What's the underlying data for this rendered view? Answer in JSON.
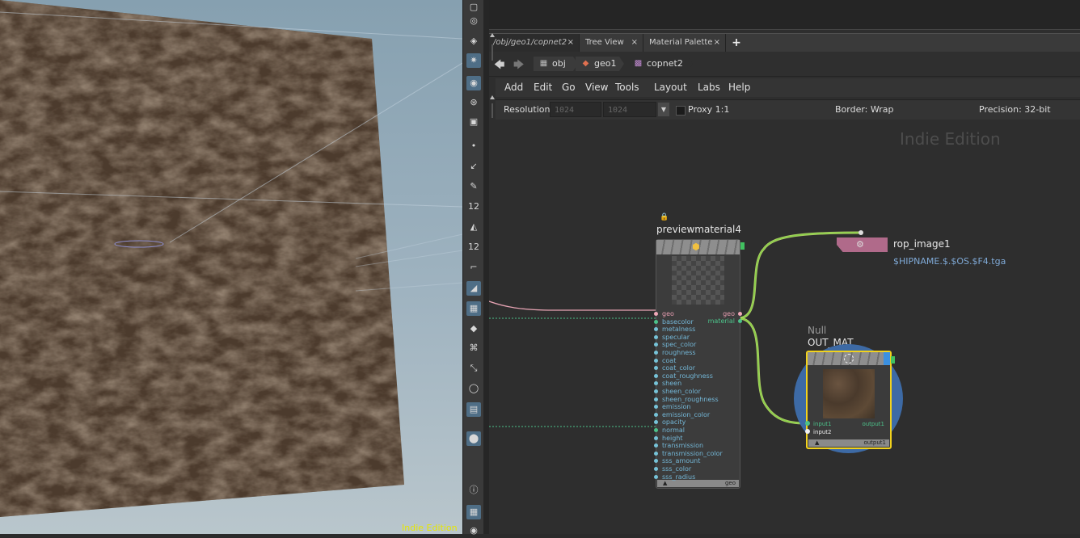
{
  "viewport": {
    "watermark": "Indie Edition"
  },
  "shelf": {
    "tools": [
      {
        "name": "select-tool",
        "glyph": "▢"
      },
      {
        "name": "view-tool",
        "glyph": "◎"
      },
      {
        "name": "handle-tool",
        "glyph": "◈"
      },
      {
        "name": "light-tool",
        "glyph": "✷"
      },
      {
        "name": "camera-tool",
        "glyph": "◉"
      },
      {
        "name": "orbit-tool",
        "glyph": "⊛"
      },
      {
        "name": "render-tool",
        "glyph": "▣"
      },
      {
        "name": "point-tool",
        "glyph": "•"
      },
      {
        "name": "edge-tool",
        "glyph": "↙"
      },
      {
        "name": "brush-tool",
        "glyph": "✎"
      },
      {
        "name": "number-tool",
        "glyph": "12"
      },
      {
        "name": "paint-tool",
        "glyph": "◭"
      },
      {
        "name": "number2-tool",
        "glyph": "12"
      },
      {
        "name": "corner-tool",
        "glyph": "⌐"
      },
      {
        "name": "plane-tool",
        "glyph": "◢"
      },
      {
        "name": "checker-tool",
        "glyph": "▦"
      },
      {
        "name": "layer-tool",
        "glyph": "◆"
      },
      {
        "name": "uv-tool",
        "glyph": "⌘"
      },
      {
        "name": "pin-tool",
        "glyph": "⤡"
      },
      {
        "name": "circle-tool",
        "glyph": "◯"
      },
      {
        "name": "image-tool",
        "glyph": "▤"
      },
      {
        "name": "marker-tool",
        "glyph": "⬤"
      },
      {
        "name": "info-tool",
        "glyph": "ⓘ"
      },
      {
        "name": "grid-tool",
        "glyph": "▦"
      },
      {
        "name": "eye-tool",
        "glyph": "◉"
      }
    ]
  },
  "tabs": [
    {
      "label": "/obj/geo1/copnet2",
      "close": "×"
    },
    {
      "label": "Tree View",
      "close": "×"
    },
    {
      "label": "Material Palette",
      "close": "×"
    }
  ],
  "tab_add": "+",
  "path": {
    "back": "🡄",
    "forward": "🡆",
    "crumbs": [
      "obj",
      "geo1",
      "copnet2"
    ]
  },
  "menu": [
    "Add",
    "Edit",
    "Go",
    "View",
    "Tools",
    "Layout",
    "Labs",
    "Help"
  ],
  "options": {
    "resolution_label": "Resolution",
    "res_x": "1024",
    "res_y": "1024",
    "proxy": "Proxy 1:1",
    "border": "Border: Wrap",
    "precision": "Precision: 32-bit"
  },
  "network": {
    "watermark": "Indie Edition",
    "preview_material": {
      "name": "previewmaterial4",
      "inputs": [
        "geo",
        "basecolor",
        "metalness",
        "specular",
        "spec_color",
        "roughness",
        "coat",
        "coat_color",
        "coat_roughness",
        "sheen",
        "sheen_color",
        "sheen_roughness",
        "emission",
        "emission_color",
        "opacity",
        "normal",
        "height",
        "transmission",
        "transmission_color",
        "sss_amount",
        "sss_color",
        "sss_radius"
      ],
      "outputs": [
        "geo",
        "material"
      ],
      "footer": "geo"
    },
    "rop": {
      "name": "rop_image1",
      "path": "$HIPNAME.$.$OS.$F4.tga"
    },
    "null": {
      "type": "Null",
      "name": "OUT_MAT",
      "inputs": [
        "input1",
        "input2"
      ],
      "output": "output1",
      "footer": "output1"
    }
  }
}
